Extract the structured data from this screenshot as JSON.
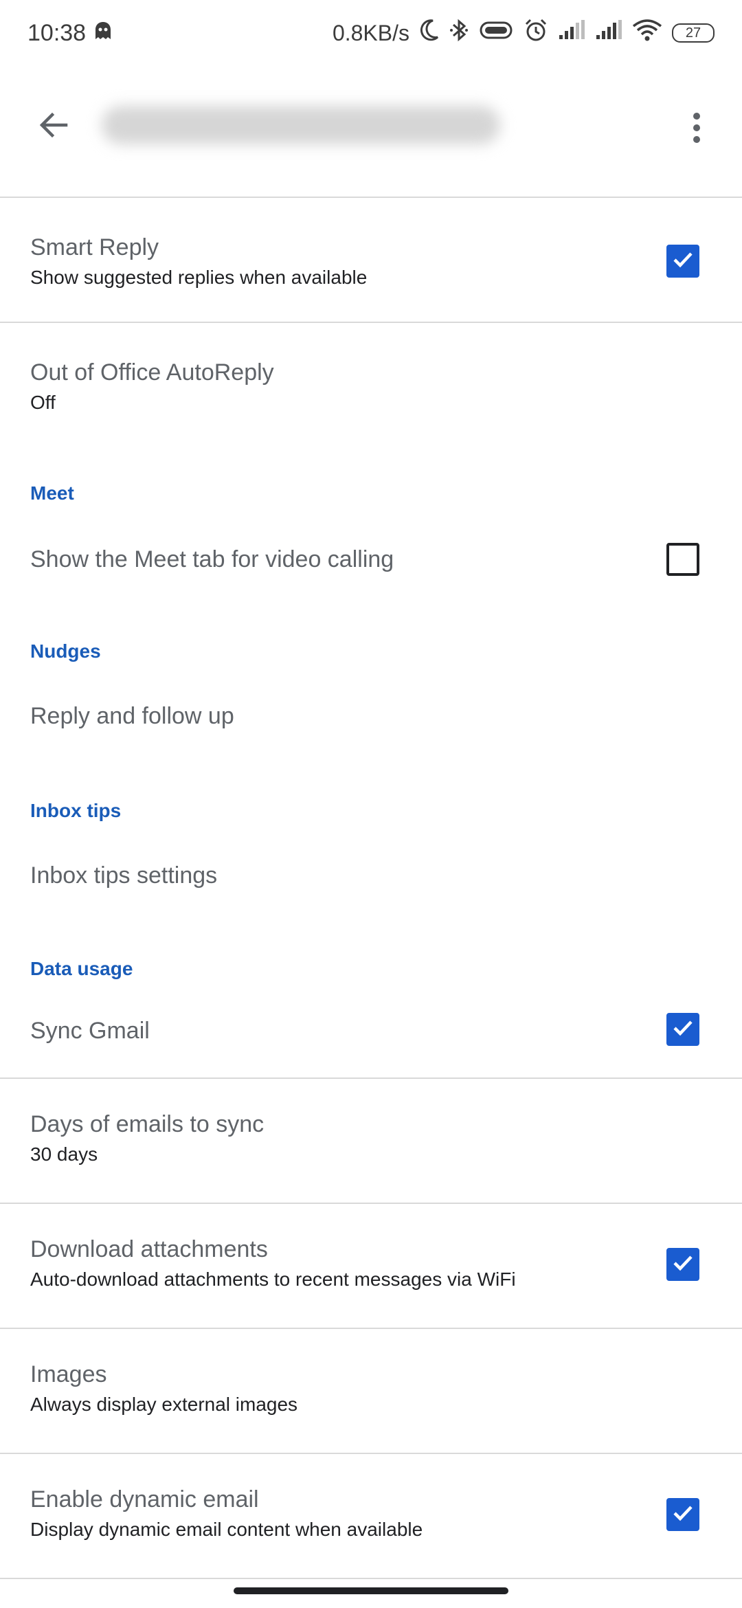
{
  "status_bar": {
    "time": "10:38",
    "network_speed": "0.8KB/s",
    "battery_level": "27",
    "icons": [
      "ghost-icon",
      "moon-icon",
      "bluetooth-icon",
      "vibrate-icon",
      "alarm-icon",
      "signal-icon",
      "signal-icon",
      "wifi-icon",
      "battery-icon"
    ]
  },
  "app_bar": {
    "title": "",
    "back_icon": "arrow-back-icon",
    "more_icon": "more-vert-icon"
  },
  "settings": {
    "smart_reply": {
      "title": "Smart Reply",
      "subtitle": "Show suggested replies when available",
      "checked": true
    },
    "out_of_office": {
      "title": "Out of Office AutoReply",
      "subtitle": "Off"
    },
    "meet_header": "Meet",
    "meet_tab": {
      "title": "Show the Meet tab for video calling",
      "checked": false
    },
    "nudges_header": "Nudges",
    "reply_follow_up": {
      "title": "Reply and follow up"
    },
    "inbox_tips_header": "Inbox tips",
    "inbox_tips_settings": {
      "title": "Inbox tips settings"
    },
    "data_usage_header": "Data usage",
    "sync_gmail": {
      "title": "Sync Gmail",
      "checked": true
    },
    "days_to_sync": {
      "title": "Days of emails to sync",
      "subtitle": "30 days"
    },
    "download_attachments": {
      "title": "Download attachments",
      "subtitle": "Auto-download attachments to recent messages via WiFi",
      "checked": true
    },
    "images": {
      "title": "Images",
      "subtitle": "Always display external images"
    },
    "dynamic_email": {
      "title": "Enable dynamic email",
      "subtitle": "Display dynamic email content when available",
      "checked": true
    }
  },
  "colors": {
    "accent": "#1a5cd0",
    "section_header": "#1a5cb8",
    "divider": "#d9d9d9"
  }
}
